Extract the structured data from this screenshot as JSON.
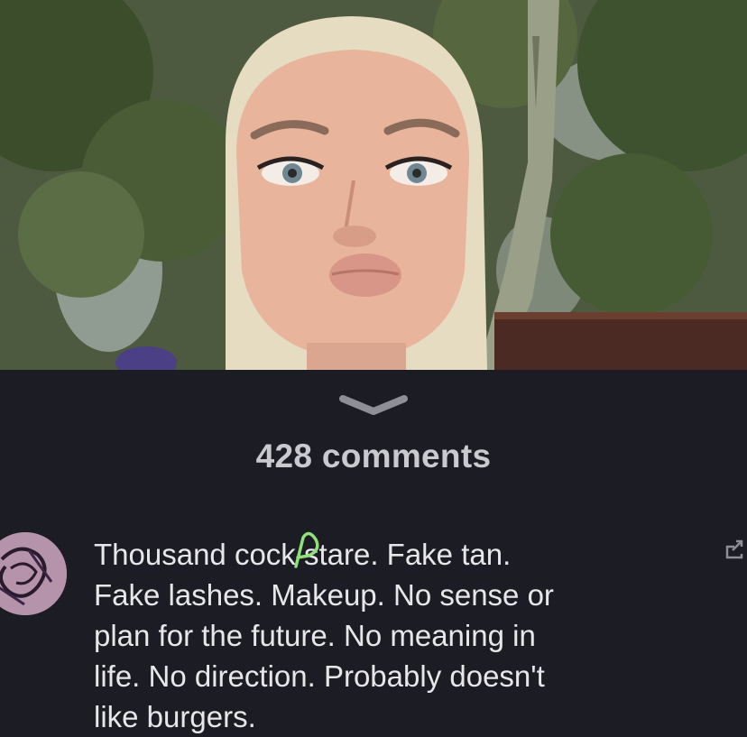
{
  "post": {
    "image_alt_icon": "photo"
  },
  "comments_sheet": {
    "collapse_icon": "chevron-down-icon",
    "count_label": "428 comments"
  },
  "comment": {
    "avatar_icon": "avatar",
    "text": "Thousand cock stare. Fake tan.\nFake lashes. Makeup. No sense or\nplan for the future. No meaning in\nlife. No direction. Probably doesn't\nlike burgers.",
    "reply_icon": "reply-icon"
  },
  "colors": {
    "sheet_background": "#1c1c24",
    "count_text": "#c9c9cf",
    "comment_text": "#e7e7ea",
    "scribble": "#8fe07a"
  }
}
